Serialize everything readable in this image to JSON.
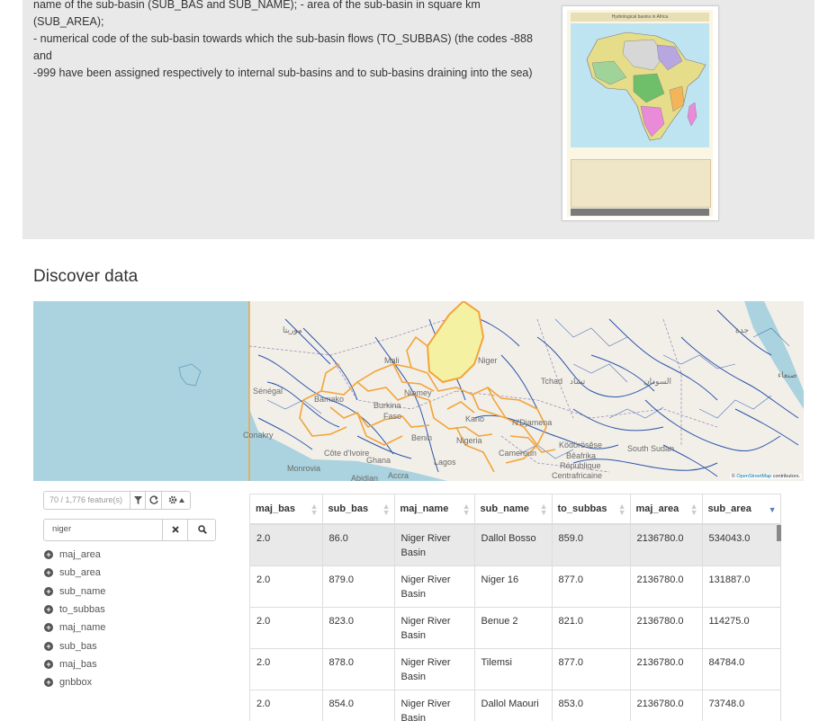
{
  "description": {
    "lines": [
      "name of the sub-basin (SUB_BAS and SUB_NAME); - area of the sub-basin in square km (SUB_AREA);",
      "- numerical code of the sub-basin towards which the sub-basin flows (TO_SUBBAS) (the codes -888 and",
      "-999 have been assigned respectively to internal sub-basins and to sub-basins draining into the sea)"
    ],
    "thumbnail_title": "Hydrological basins in Africa"
  },
  "section_title": "Discover data",
  "map": {
    "labels": [
      "موريتا",
      "Mali",
      "Niger",
      "Sénégal",
      "Bamako",
      "Burkina",
      "Faso",
      "Niamey",
      "Tchad",
      "تشاد",
      "N'Djamena",
      "Kano",
      "Conakry",
      "Côte d'Ivoire",
      "Ghana",
      "Accra",
      "Abidjan",
      "Monrovia",
      "Lagos",
      "Nigeria",
      "Benin",
      "Cameroun",
      "Ködörösêse",
      "Bêafrika",
      "République",
      "Centrafricaine",
      "South Sudan",
      "السودان",
      "صنعاء",
      "جدة"
    ],
    "attribution_prefix": "©",
    "attribution_link": "OpenStreetMap",
    "attribution_suffix": "contributors."
  },
  "features": {
    "count_text": "70 / 1,776 feature(s)",
    "filter_icon": "filter-icon",
    "refresh_icon": "refresh-icon",
    "settings_icon": "gear-icon"
  },
  "search": {
    "value": "niger",
    "clear_icon": "close-icon",
    "search_icon": "search-icon"
  },
  "fields": [
    "maj_area",
    "sub_area",
    "sub_name",
    "to_subbas",
    "maj_name",
    "sub_bas",
    "maj_bas",
    "gnbbox"
  ],
  "table": {
    "columns": [
      "maj_bas",
      "sub_bas",
      "maj_name",
      "sub_name",
      "to_subbas",
      "maj_area",
      "sub_area"
    ],
    "sorted_column": "sub_area",
    "rows": [
      [
        "2.0",
        "86.0",
        "Niger River Basin",
        "Dallol Bosso",
        "859.0",
        "2136780.0",
        "534043.0"
      ],
      [
        "2.0",
        "879.0",
        "Niger River Basin",
        "Niger 16",
        "877.0",
        "2136780.0",
        "131887.0"
      ],
      [
        "2.0",
        "823.0",
        "Niger River Basin",
        "Benue 2",
        "821.0",
        "2136780.0",
        "114275.0"
      ],
      [
        "2.0",
        "878.0",
        "Niger River Basin",
        "Tilemsi",
        "877.0",
        "2136780.0",
        "84784.0"
      ],
      [
        "2.0",
        "854.0",
        "Niger River Basin",
        "Dallol Maouri",
        "853.0",
        "2136780.0",
        "73748.0"
      ]
    ]
  }
}
